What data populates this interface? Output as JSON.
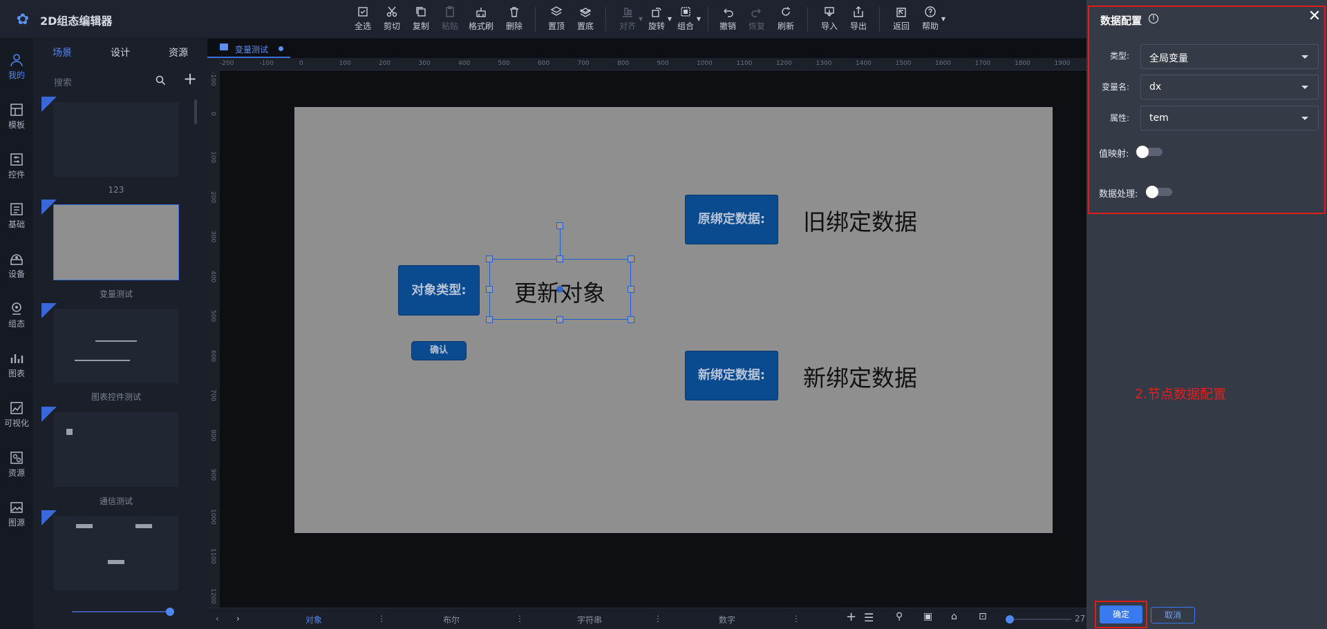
{
  "app": {
    "title": "2D组态编辑器"
  },
  "toolbar": {
    "select_all": "全选",
    "cut": "剪切",
    "copy": "复制",
    "paste": "粘贴",
    "format_brush": "格式刷",
    "delete": "删除",
    "bring_top": "置顶",
    "send_bottom": "置底",
    "align": "对齐",
    "rotate": "旋转",
    "group": "组合",
    "undo": "撤销",
    "redo": "恢复",
    "refresh": "刷新",
    "import": "导入",
    "export": "导出",
    "back": "返回",
    "help": "帮助"
  },
  "nav": {
    "items": [
      "我的",
      "模板",
      "控件",
      "基础",
      "设备",
      "组态",
      "图表",
      "可视化",
      "资源",
      "图源"
    ]
  },
  "library": {
    "tabs": [
      "场景",
      "设计",
      "资源"
    ],
    "search_placeholder": "搜索",
    "plus": "+",
    "thumbs": [
      "123",
      "变量测试",
      "图表控件测试",
      "通信测试"
    ]
  },
  "editor": {
    "tab": "变量测试"
  },
  "ruler": {
    "h": [
      "-200",
      "-100",
      "0",
      "100",
      "200",
      "300",
      "400",
      "500",
      "600",
      "700",
      "800",
      "900",
      "1000",
      "1100",
      "1200",
      "1300",
      "1400",
      "1500",
      "1600",
      "1700",
      "1800",
      "1900"
    ],
    "v": [
      "-100",
      "0",
      "100",
      "200",
      "300",
      "400",
      "500",
      "600",
      "700",
      "800",
      "900",
      "1000",
      "1100",
      "1200"
    ]
  },
  "canvas": {
    "obj_type_label": "对象类型:",
    "selected_text": "更新对象",
    "confirm_label": "确认",
    "orig_label": "原绑定数据:",
    "orig_value": "旧绑定数据",
    "new_label": "新绑定数据:",
    "new_value": "新绑定数据"
  },
  "bottom": {
    "tabs": [
      "对象",
      "布尔",
      "字符串",
      "数字"
    ],
    "zoom": "27"
  },
  "panel": {
    "title": "数据配置",
    "type_label": "类型:",
    "type_value": "全局变量",
    "var_label": "变量名:",
    "var_value": "dx",
    "attr_label": "属性:",
    "attr_value": "tem",
    "value_map_label": "值映射:",
    "data_proc_label": "数据处理:",
    "annotation": "2.节点数据配置",
    "ok": "确定",
    "cancel": "取消"
  },
  "colors": {
    "accent": "#3a7af0",
    "annotation": "#e01d1d",
    "object_button": "#0a4a8e",
    "canvas": "#8f8f8f"
  }
}
